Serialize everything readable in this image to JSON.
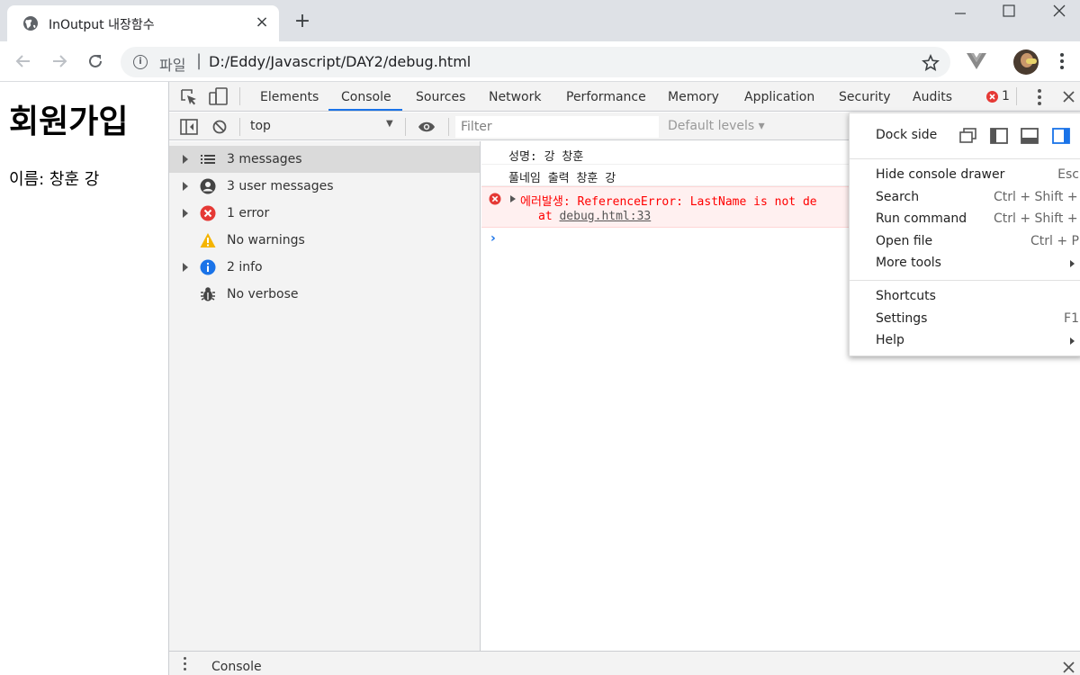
{
  "browser": {
    "tab_title": "InOutput 내장함수",
    "tab_close": "×",
    "new_tab": "+",
    "url_scheme": "파일",
    "url": "D:/Eddy/Javascript/DAY2/debug.html"
  },
  "page": {
    "heading": "회원가입",
    "line": "이름: 창훈 강"
  },
  "devtools": {
    "tabs": [
      "Elements",
      "Console",
      "Sources",
      "Network",
      "Performance",
      "Memory",
      "Application",
      "Security",
      "Audits"
    ],
    "error_count": "1",
    "context": "top",
    "filter_placeholder": "Filter",
    "levels_label": "Default levels ▾",
    "sidebar": [
      {
        "label": "3 messages",
        "icon": "list-icon",
        "expandable": true,
        "selected": true
      },
      {
        "label": "3 user messages",
        "icon": "user-icon",
        "expandable": true,
        "selected": false
      },
      {
        "label": "1 error",
        "icon": "error-icon",
        "expandable": true,
        "selected": false
      },
      {
        "label": "No warnings",
        "icon": "warning-icon",
        "expandable": false,
        "selected": false
      },
      {
        "label": "2 info",
        "icon": "info-icon",
        "expandable": true,
        "selected": false
      },
      {
        "label": "No verbose",
        "icon": "bug-icon",
        "expandable": false,
        "selected": false
      }
    ],
    "logs": [
      "성명: 강 창훈",
      "풀네임 출력 창훈 강"
    ],
    "error": {
      "message": "에러발생:  ReferenceError: LastName is not de",
      "at_prefix": "at ",
      "link": "debug.html:33"
    },
    "drawer_title": "Console",
    "menu": {
      "dock_side": "Dock side",
      "items": [
        {
          "label": "Hide console drawer",
          "shortcut": "Esc"
        },
        {
          "label": "Search",
          "shortcut": "Ctrl + Shift + F"
        },
        {
          "label": "Run command",
          "shortcut": "Ctrl + Shift + P"
        },
        {
          "label": "Open file",
          "shortcut": "Ctrl + P"
        },
        {
          "label": "More tools",
          "shortcut": ""
        }
      ],
      "items2": [
        {
          "label": "Shortcuts",
          "shortcut": ""
        },
        {
          "label": "Settings",
          "shortcut": "F1"
        },
        {
          "label": "Help",
          "shortcut": ""
        }
      ]
    }
  },
  "colors": {
    "accent": "#1a73e8",
    "error_red": "#e53935",
    "warning_yellow": "#f4b400",
    "info_blue": "#1a73e8"
  }
}
